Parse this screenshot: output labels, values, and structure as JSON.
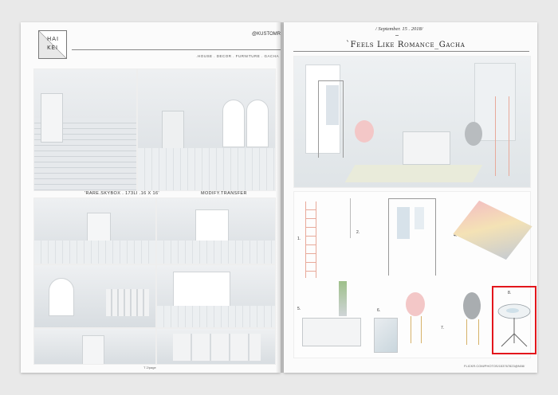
{
  "left_page": {
    "logo": {
      "line1": "HAI",
      "line2": "KEI"
    },
    "brand": "@KUSTOMR",
    "tagline": ".HOUSE . DECOR . FURNITURE . GACHA",
    "captions": {
      "skybox": "'RARE.SKYBOX . 173LI .16 X 16'",
      "modify": "MODIFY.TRANSFER"
    },
    "page_number": "T 2/page"
  },
  "right_page": {
    "date": "/ September. 15 . 2018/",
    "title": "`Feels Like Romance_Gacha",
    "item_numbers": [
      "1.",
      "2.",
      "3.",
      "4.",
      "5.",
      "6.",
      "7.",
      "8."
    ],
    "footer": "FLICKR.COM/PHOTOS/153767823@N08/"
  },
  "colors": {
    "highlight": "#e3161c"
  }
}
